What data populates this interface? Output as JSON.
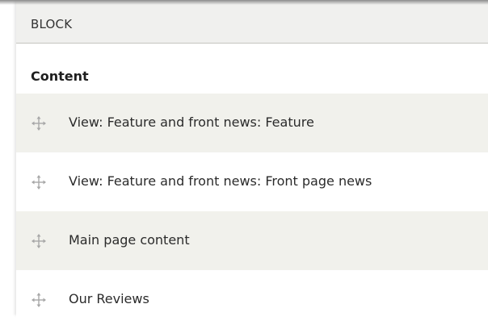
{
  "block_header": {
    "label": "BLOCK"
  },
  "region": {
    "title": "Content"
  },
  "rows": [
    {
      "label": "View: Feature and front news: Feature",
      "icon": "drag-handle-icon"
    },
    {
      "label": "View: Feature and front news: Front page news",
      "icon": "drag-handle-icon"
    },
    {
      "label": "Main page content",
      "icon": "drag-handle-icon"
    },
    {
      "label": "Our Reviews",
      "icon": "drag-handle-icon"
    }
  ],
  "colors": {
    "header_bg": "#f0f0ee",
    "row_striped_bg": "#f1f1ec",
    "handle_color": "#a8a8a8"
  }
}
